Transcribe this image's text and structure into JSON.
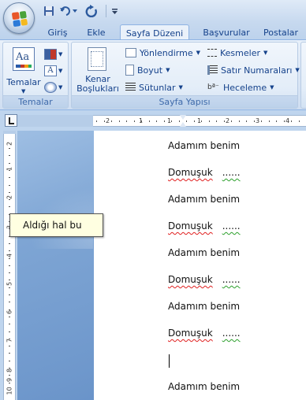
{
  "quick_access": {
    "save_icon": "save-icon",
    "undo_icon": "undo-icon",
    "redo_icon": "redo-icon",
    "customize_icon": "dropdown-icon"
  },
  "tabs": [
    {
      "label": "Giriş",
      "active": false
    },
    {
      "label": "Ekle",
      "active": false
    },
    {
      "label": "Sayfa Düzeni",
      "active": true
    },
    {
      "label": "Başvurular",
      "active": false
    },
    {
      "label": "Postalar",
      "active": false
    }
  ],
  "ribbon": {
    "themes_group": {
      "label": "Temalar",
      "themes_button": "Temalar"
    },
    "page_setup_group": {
      "label": "Sayfa Yapısı",
      "margins_line1": "Kenar",
      "margins_line2": "Boşlukları",
      "orientation": "Yönlendirme",
      "size": "Boyut",
      "columns": "Sütunlar",
      "breaks": "Kesmeler",
      "line_numbers": "Satır Numaraları",
      "hyphenation": "Heceleme"
    }
  },
  "ruler": {
    "horizontal_labels": [
      "2",
      "1",
      "1",
      "1",
      "2",
      "3",
      "4"
    ],
    "vertical_labels": [
      "2",
      "1",
      "2",
      "3",
      "4",
      "5",
      "6",
      "7",
      "8",
      "9",
      "10"
    ]
  },
  "document": {
    "lines": [
      {
        "text": "Adamım benim",
        "misspelled": false,
        "trailing": ""
      },
      {
        "text": "Domuşuk",
        "misspelled": true,
        "trailing": "......"
      },
      {
        "text": "Adamım benim",
        "misspelled": false,
        "trailing": ""
      },
      {
        "text": "Domuşuk",
        "misspelled": true,
        "trailing": "......"
      },
      {
        "text": "Adamım benim",
        "misspelled": false,
        "trailing": ""
      },
      {
        "text": "Domuşuk",
        "misspelled": true,
        "trailing": "......"
      },
      {
        "text": "Adamım benim",
        "misspelled": false,
        "trailing": ""
      },
      {
        "text": "Domuşuk",
        "misspelled": true,
        "trailing": "......"
      },
      {
        "text": "",
        "misspelled": false,
        "trailing": ""
      },
      {
        "text": "Adamım benim",
        "misspelled": false,
        "trailing": ""
      }
    ]
  },
  "tooltip": {
    "text": "Aldığı hal bu"
  },
  "colors": {
    "ribbon_text": "#15428b",
    "spell_error": "#e02020",
    "grammar_mark": "#2ca02c",
    "tooltip_bg": "#ffffe1"
  }
}
